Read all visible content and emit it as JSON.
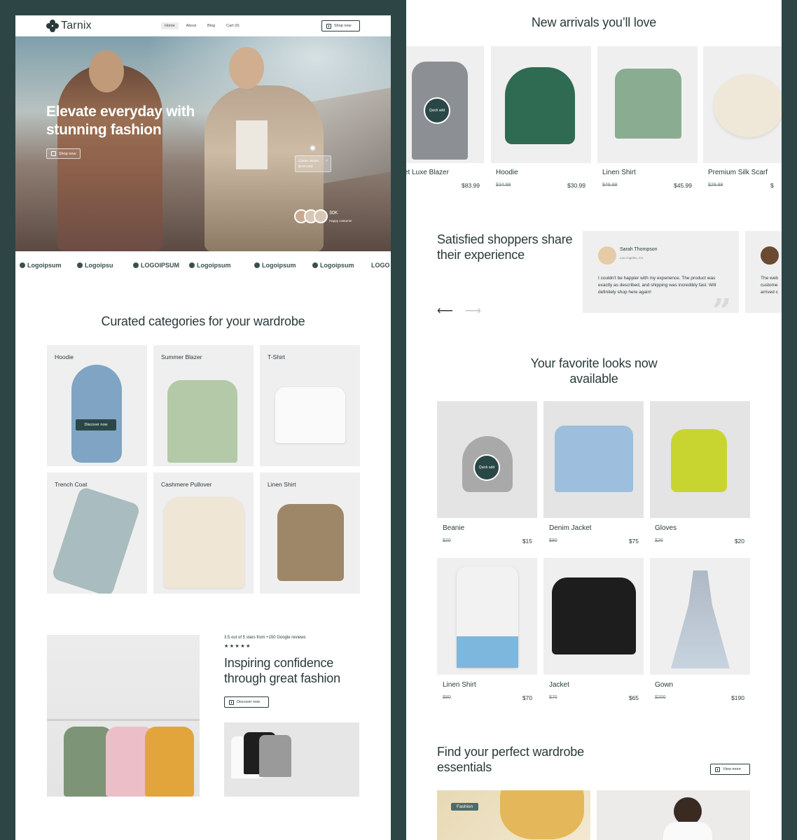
{
  "brand": {
    "name": "Tarnix"
  },
  "nav": {
    "links": [
      "Home",
      "About",
      "Blog",
      "Cart (0)"
    ],
    "cta": "Shop now"
  },
  "hero": {
    "title": "Elevate everyday with stunning fashion",
    "cta": "Shop now",
    "product_tag": {
      "name": "Classic Jacket",
      "price": "$120 USD"
    },
    "customers": {
      "count": "30K",
      "label": "Happy costumer"
    }
  },
  "logos": [
    "Logoipsum",
    "Logoipsu",
    "LOGOIPSUM",
    "Logoipsum",
    "Logoipsum",
    "Logoipsum",
    "LOGO"
  ],
  "categories": {
    "title": "Curated categories for your wardrobe",
    "discover_label": "Discover now",
    "items": [
      "Hoodie",
      "Summer Blazer",
      "T-Shirt",
      "Trench Coat",
      "Cashmere Pullover",
      "Linen Shirt"
    ]
  },
  "confidence": {
    "rating": "3.5 out of 5 stars from +150 Google reviews",
    "stars": "★★★★★",
    "title": "Inspiring confidence through great fashion",
    "cta": "Discover now"
  },
  "new_arrivals": {
    "title": "New arrivals you’ll love",
    "quick_add": "Quick add",
    "items": [
      {
        "name": "et Luxe Blazer",
        "old": "",
        "price": "$83.99"
      },
      {
        "name": "Hoodie",
        "old": "$34.99",
        "price": "$30.99"
      },
      {
        "name": "Linen Shirt",
        "old": "$49.99",
        "price": "$45.99"
      },
      {
        "name": "Premium Silk Scarf",
        "old": "$29.99",
        "price": "$"
      }
    ]
  },
  "testimonials": {
    "title": "Satisfied shoppers share their experience",
    "items": [
      {
        "name": "Sarah Thompson",
        "location": "Los Angeles, CA",
        "text": "I couldn't be happier with my experience. The product was exactly as described, and shipping was incredibly fast. Will definitely shop here again!"
      },
      {
        "name": "",
        "location": "",
        "text": "The web custome arrived c"
      }
    ]
  },
  "favorites": {
    "title": "Your favorite looks now available",
    "quick_add": "Quick add",
    "items": [
      {
        "name": "Beanie",
        "old": "$20",
        "price": "$15"
      },
      {
        "name": "Denim Jacket",
        "old": "$80",
        "price": "$75"
      },
      {
        "name": "Gloves",
        "old": "$25",
        "price": "$20"
      },
      {
        "name": "Linen Shirt",
        "old": "$80",
        "price": "$70"
      },
      {
        "name": "Jacket",
        "old": "$70",
        "price": "$65"
      },
      {
        "name": "Gown",
        "old": "$200",
        "price": "$190"
      }
    ]
  },
  "essentials": {
    "title": "Find your perfect wardrobe essentials",
    "cta": "View more",
    "tag": "Fashion"
  },
  "colors": {
    "page_bg": "#2d4545",
    "accent": "#2a4747",
    "card_bg": "#efefef"
  }
}
